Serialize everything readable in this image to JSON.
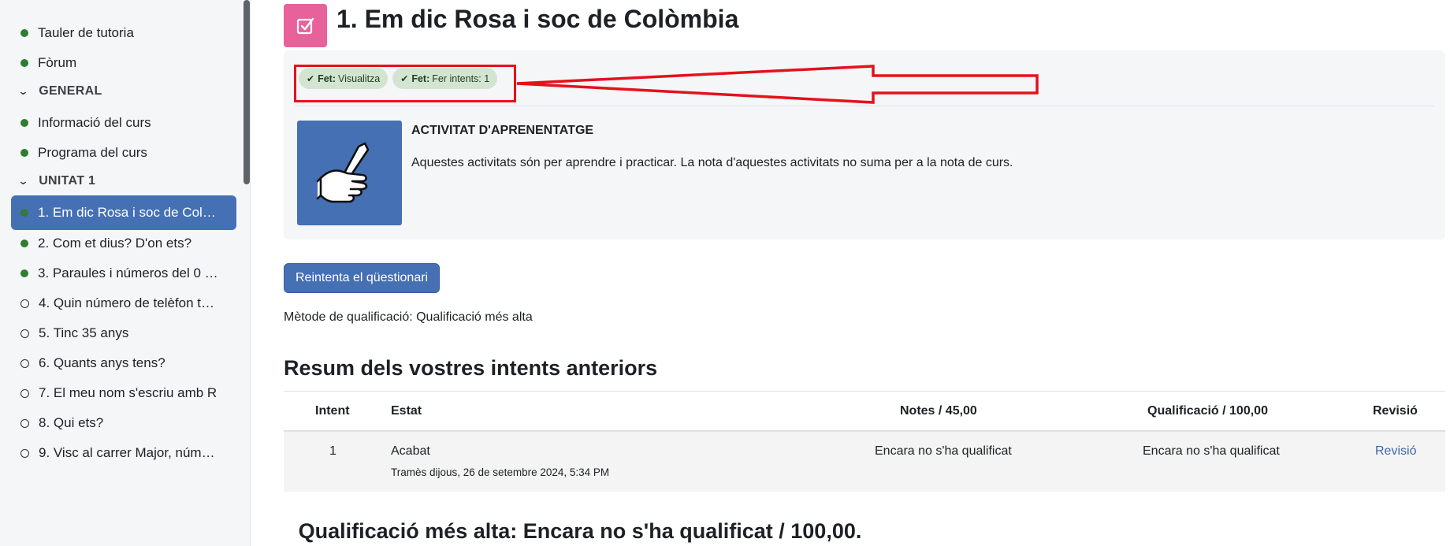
{
  "sidebar": {
    "items": [
      {
        "label": "Tauler de tutoria",
        "status": "done"
      },
      {
        "label": "Fòrum",
        "status": "done"
      }
    ],
    "section_general": "GENERAL",
    "general_items": [
      {
        "label": "Informació del curs",
        "status": "done"
      },
      {
        "label": "Programa del curs",
        "status": "done"
      }
    ],
    "section_unit": "UNITAT 1",
    "unit_items": [
      {
        "label": "1. Em dic Rosa i soc de Colò…",
        "status": "done",
        "active": true
      },
      {
        "label": "2. Com et dius? D'on ets?",
        "status": "done"
      },
      {
        "label": "3. Paraules i números del 0 a…",
        "status": "done"
      },
      {
        "label": "4. Quin número de telèfon t…",
        "status": "todo"
      },
      {
        "label": "5. Tinc 35 anys",
        "status": "todo"
      },
      {
        "label": "6. Quants anys tens?",
        "status": "todo"
      },
      {
        "label": "7. El meu nom s'escriu amb R",
        "status": "todo"
      },
      {
        "label": "8. Qui ets?",
        "status": "todo"
      },
      {
        "label": "9. Visc al carrer Major, núm…",
        "status": "todo"
      }
    ]
  },
  "header": {
    "title": "1. Em dic Rosa i soc de Colòmbia",
    "icon": "quiz-checkbox-icon",
    "icon_color": "#e8619a"
  },
  "completion": {
    "badge1_strong": "Fet:",
    "badge1_text": "Visualitza",
    "badge2_strong": "Fet:",
    "badge2_text": "Fer intents: 1"
  },
  "activity_info": {
    "title": "ACTIVITAT D'APRENENTATGE",
    "description": "Aquestes activitats són per aprendre i practicar. La nota d'aquestes activitats no suma per a la nota de curs.",
    "image_icon": "hand-writing-pencil-icon"
  },
  "actions": {
    "retry_label": "Reintenta el qüestionari",
    "grading_method": "Mètode de qualificació: Qualificació més alta"
  },
  "summary": {
    "title": "Resum dels vostres intents anteriors",
    "columns": [
      "Intent",
      "Estat",
      "Notes / 45,00",
      "Qualificació / 100,00",
      "Revisió"
    ],
    "rows": [
      {
        "attempt": "1",
        "state": "Acabat",
        "submitted": "Tramès dijous, 26 de setembre 2024, 5:34 PM",
        "marks": "Encara no s'ha qualificat",
        "grade": "Encara no s'ha qualificat",
        "review": "Revisió"
      }
    ]
  },
  "highest_grade": "Qualificació més alta: Encara no s'ha qualificat / 100,00.",
  "colors": {
    "accent": "#4570b4",
    "annotation": "#e3121b",
    "done": "#2f7d32"
  }
}
